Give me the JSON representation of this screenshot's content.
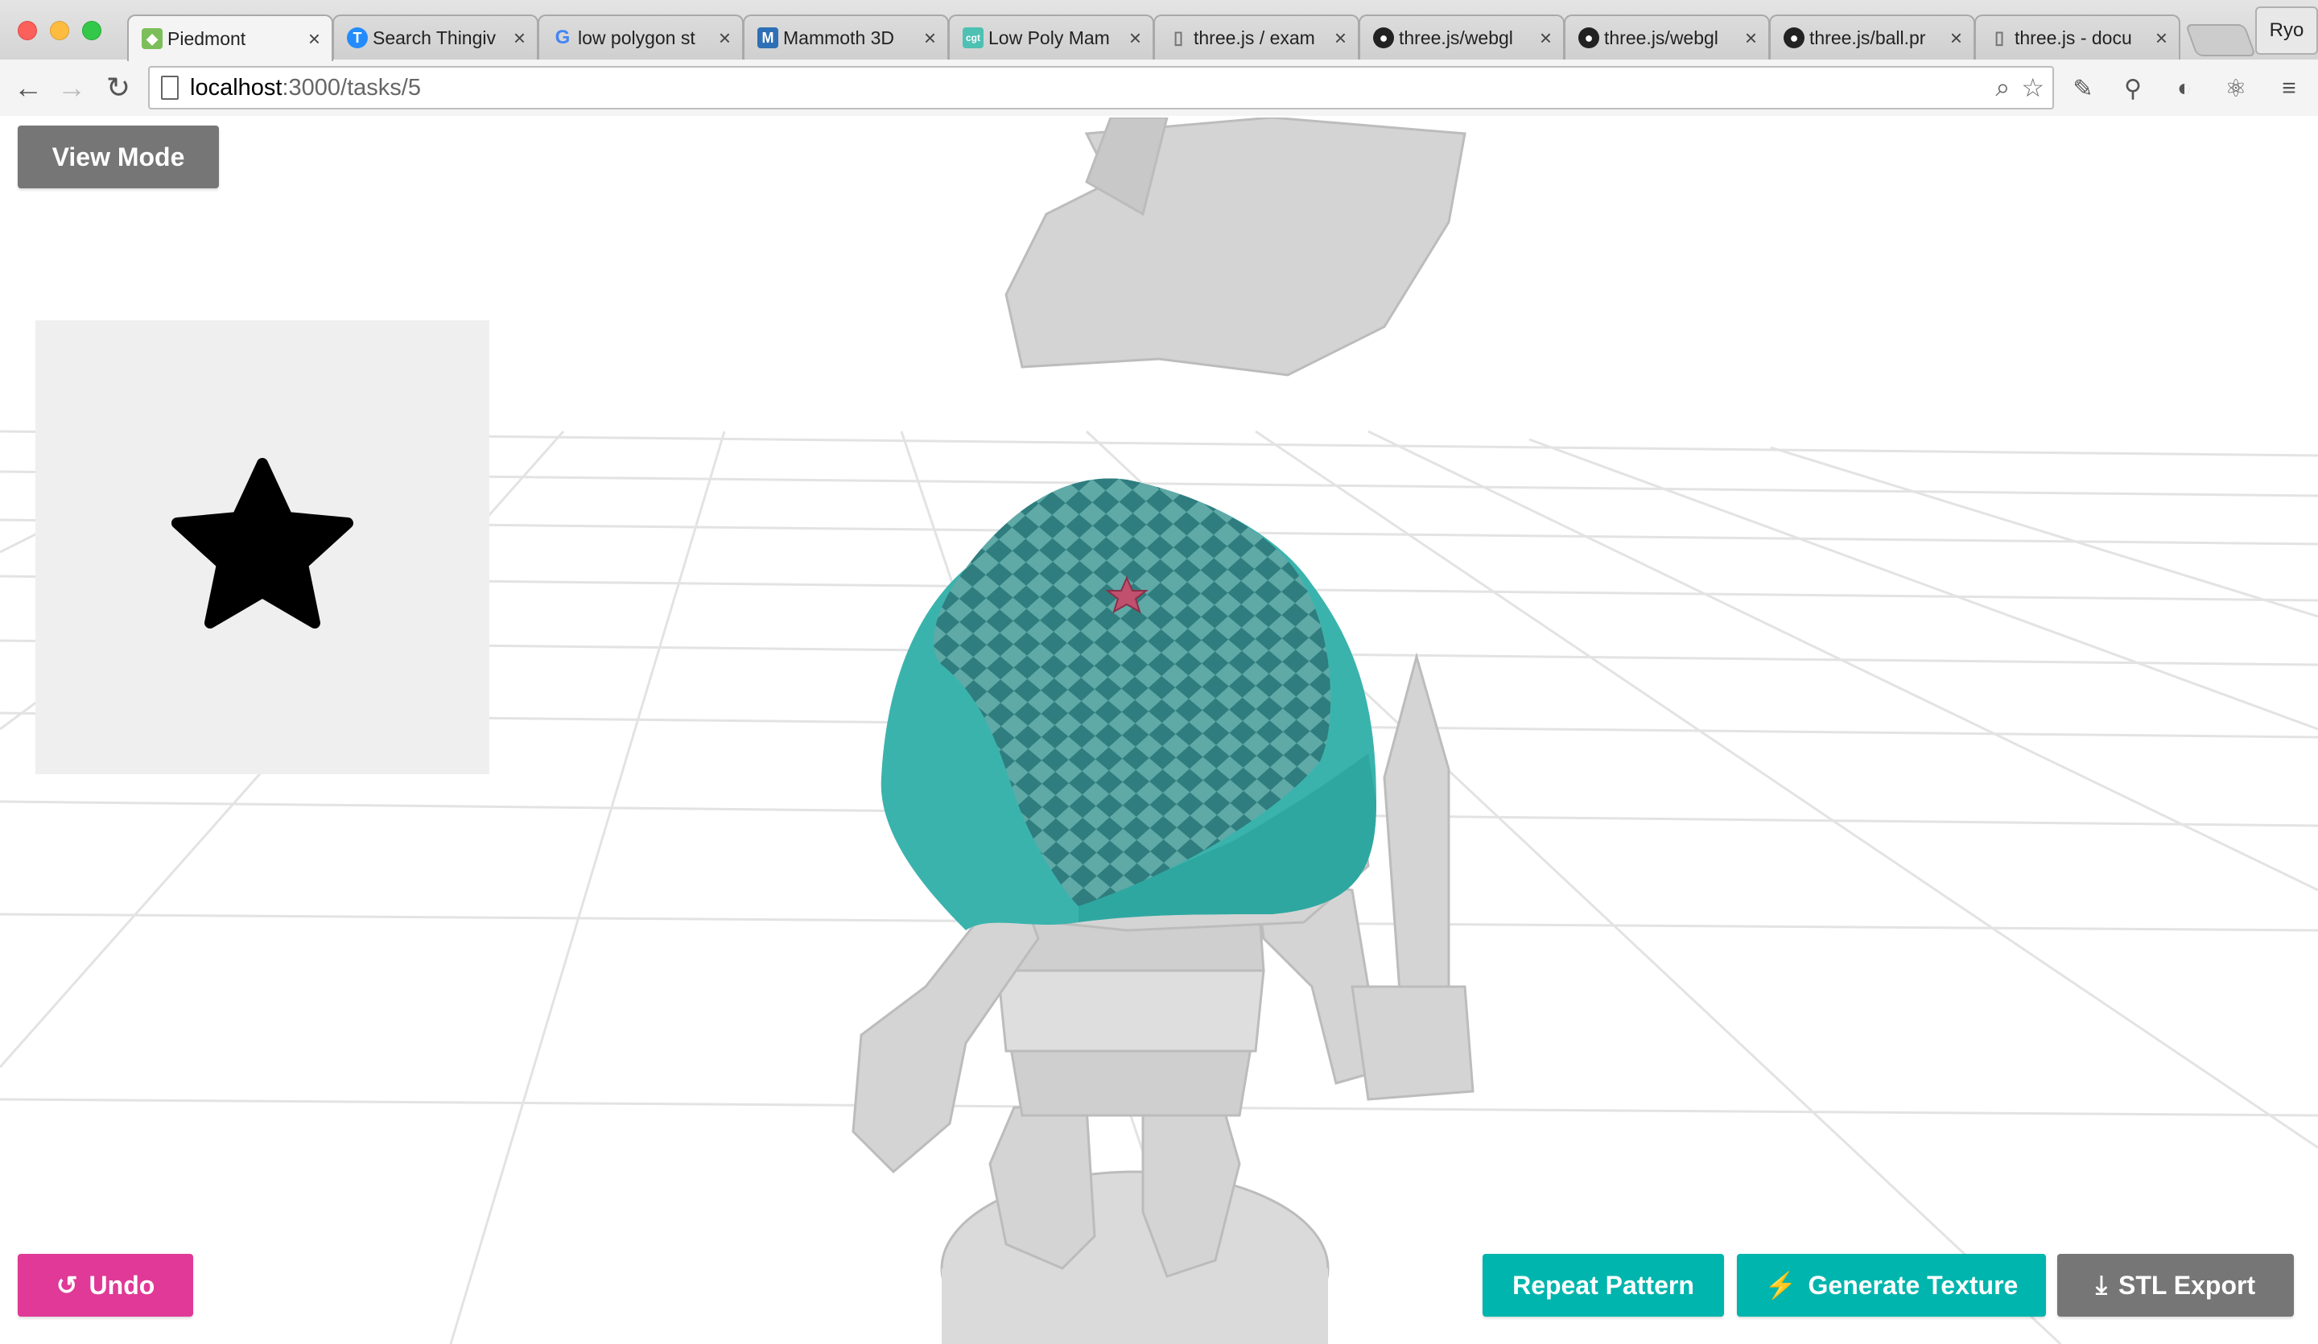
{
  "browser": {
    "tabs": [
      {
        "title": "Piedmont",
        "icon": "cube-icon",
        "color": "#7cbf5a",
        "active": true
      },
      {
        "title": "Search Thingiv",
        "icon": "thingiverse-icon",
        "color": "#248bfb"
      },
      {
        "title": "low polygon st",
        "icon": "google-icon",
        "color": "#4285f4"
      },
      {
        "title": "Mammoth 3D",
        "icon": "mammoth-icon",
        "color": "#2f6fb5"
      },
      {
        "title": "Low Poly Mam",
        "icon": "cgtrader-icon",
        "color": "#4ec1b3"
      },
      {
        "title": "three.js / exam",
        "icon": "document-icon",
        "color": "#888888"
      },
      {
        "title": "three.js/webgl",
        "icon": "github-icon",
        "color": "#222222"
      },
      {
        "title": "three.js/webgl",
        "icon": "github-icon",
        "color": "#222222"
      },
      {
        "title": "three.js/ball.pr",
        "icon": "github-icon",
        "color": "#222222"
      },
      {
        "title": "three.js - docu",
        "icon": "document-icon",
        "color": "#888888"
      }
    ],
    "profile_name": "Ryo",
    "url_host": "localhost",
    "url_path": ":3000/tasks/5"
  },
  "app": {
    "view_mode_label": "View Mode",
    "undo_label": "Undo",
    "repeat_pattern_label": "Repeat Pattern",
    "generate_texture_label": "Generate Texture",
    "stl_export_label": "STL Export",
    "pattern_preview_shape": "star-icon"
  },
  "colors": {
    "teal": "#00b5ad",
    "pink": "#e03997",
    "grey_button": "#767676",
    "model_grey": "#d2d2d2",
    "star_mark": "#c0506e"
  }
}
